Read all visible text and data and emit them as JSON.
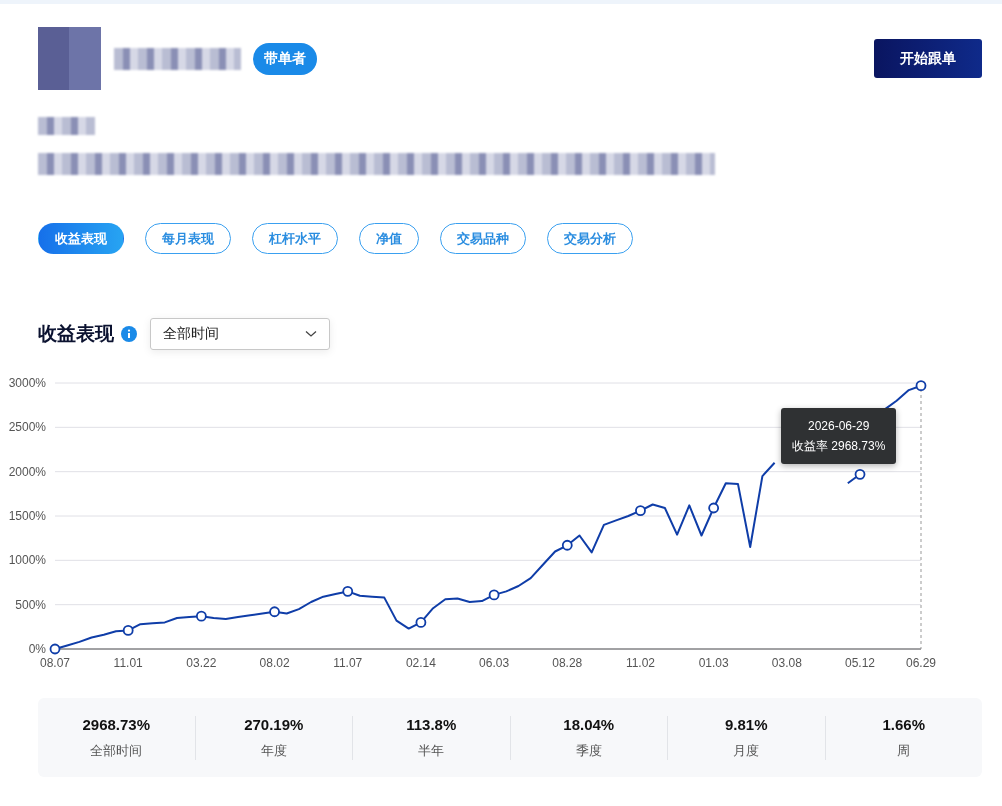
{
  "profile": {
    "badge": "带单者",
    "follow_button": "开始跟单"
  },
  "tabs": [
    {
      "label": "收益表现",
      "selected": true
    },
    {
      "label": "每月表现",
      "selected": false
    },
    {
      "label": "杠杆水平",
      "selected": false
    },
    {
      "label": "净值",
      "selected": false
    },
    {
      "label": "交易品种",
      "selected": false
    },
    {
      "label": "交易分析",
      "selected": false
    }
  ],
  "performance": {
    "title": "收益表现",
    "period_select": {
      "value": "全部时间"
    },
    "tooltip": {
      "date": "2026-06-29",
      "value": "2968.73%"
    },
    "chart_data": {
      "type": "line",
      "ylim": [
        0,
        3000
      ],
      "grid": true,
      "categories": [
        "08.07",
        null,
        null,
        null,
        null,
        null,
        "11.01",
        null,
        null,
        null,
        null,
        null,
        "03.22",
        null,
        null,
        null,
        null,
        null,
        "08.02",
        null,
        null,
        null,
        null,
        null,
        "11.07",
        null,
        null,
        null,
        null,
        null,
        "02.14",
        null,
        null,
        null,
        null,
        null,
        "06.03",
        null,
        null,
        null,
        null,
        null,
        "08.28",
        null,
        null,
        null,
        null,
        null,
        "11.02",
        null,
        null,
        null,
        null,
        null,
        "01.03",
        null,
        null,
        null,
        null,
        null,
        "03.08",
        null,
        null,
        null,
        null,
        null,
        "05.12",
        null,
        null,
        null,
        null,
        "06.29"
      ],
      "yticks": [
        {
          "value": 0,
          "label": "0%"
        },
        {
          "value": 500,
          "label": "500%"
        },
        {
          "value": 1000,
          "label": "1000%"
        },
        {
          "value": 1500,
          "label": "1500%"
        },
        {
          "value": 2000,
          "label": "2000%"
        },
        {
          "value": 2500,
          "label": "2500%"
        },
        {
          "value": 3000,
          "label": "3000%"
        }
      ],
      "series": [
        {
          "name": "收益率",
          "color": "#0f3da8",
          "values": [
            0,
            40,
            80,
            130,
            160,
            200,
            210,
            280,
            290,
            300,
            350,
            360,
            370,
            350,
            340,
            360,
            380,
            400,
            420,
            400,
            450,
            530,
            590,
            620,
            650,
            600,
            590,
            580,
            320,
            230,
            300,
            460,
            560,
            570,
            530,
            540,
            610,
            650,
            710,
            800,
            950,
            1100,
            1170,
            1280,
            1090,
            1400,
            1450,
            1500,
            1560,
            1630,
            1590,
            1290,
            1620,
            1280,
            1590,
            1870,
            1860,
            1150,
            1950,
            2100,
            null,
            null,
            null,
            null,
            null,
            1870,
            1970,
            null,
            2700,
            2800,
            2920,
            2970
          ]
        }
      ]
    }
  },
  "stats": [
    {
      "value": "2968.73%",
      "label": "全部时间"
    },
    {
      "value": "270.19%",
      "label": "年度"
    },
    {
      "value": "113.8%",
      "label": "半年"
    },
    {
      "value": "18.04%",
      "label": "季度"
    },
    {
      "value": "9.81%",
      "label": "月度"
    },
    {
      "value": "1.66%",
      "label": "周"
    }
  ]
}
